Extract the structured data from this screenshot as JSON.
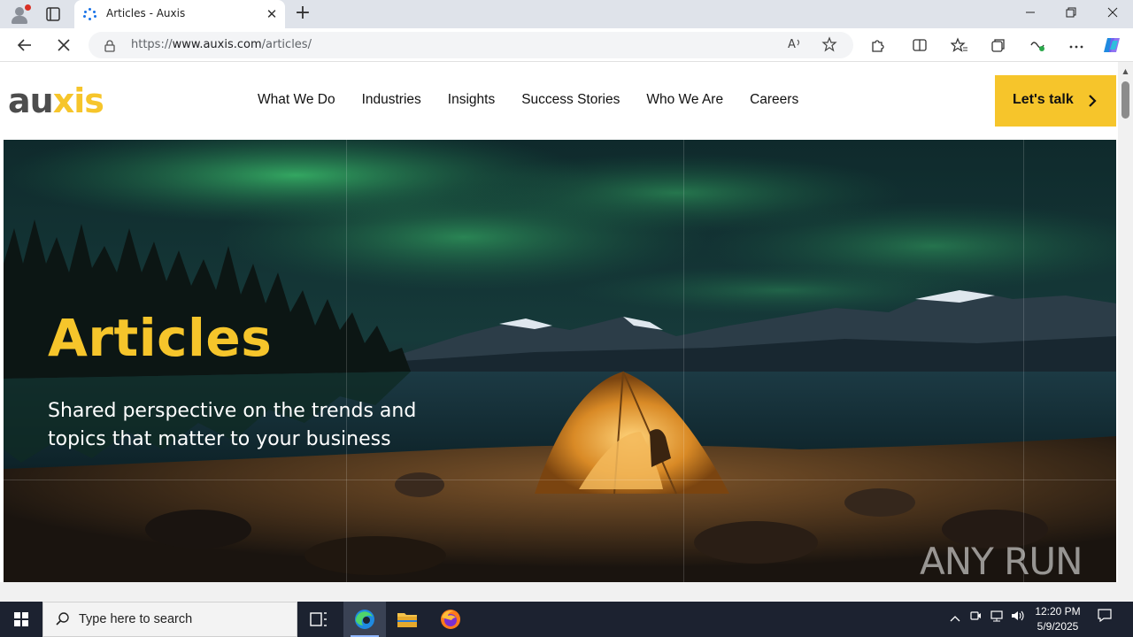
{
  "browser": {
    "tab_title": "Articles - Auxis",
    "url_prefix": "https://",
    "url_host": "www.auxis.com",
    "url_path": "/articles/",
    "new_tab_symbol": "+",
    "tab_close_symbol": "✕"
  },
  "site": {
    "logo_part1": "au",
    "logo_part2": "xis",
    "nav": [
      "What We Do",
      "Industries",
      "Insights",
      "Success Stories",
      "Who We Are",
      "Careers"
    ],
    "cta_label": "Let's talk"
  },
  "hero": {
    "title": "Articles",
    "subtitle": "Shared perspective on the trends and topics that matter to your business"
  },
  "watermark": "ANY RUN",
  "taskbar": {
    "search_placeholder": "Type here to search",
    "time": "12:20 PM",
    "date": "5/9/2025"
  },
  "colors": {
    "brand_yellow": "#f6c52b",
    "logo_gray": "#4d4d4d",
    "taskbar_bg": "#1c2230"
  }
}
